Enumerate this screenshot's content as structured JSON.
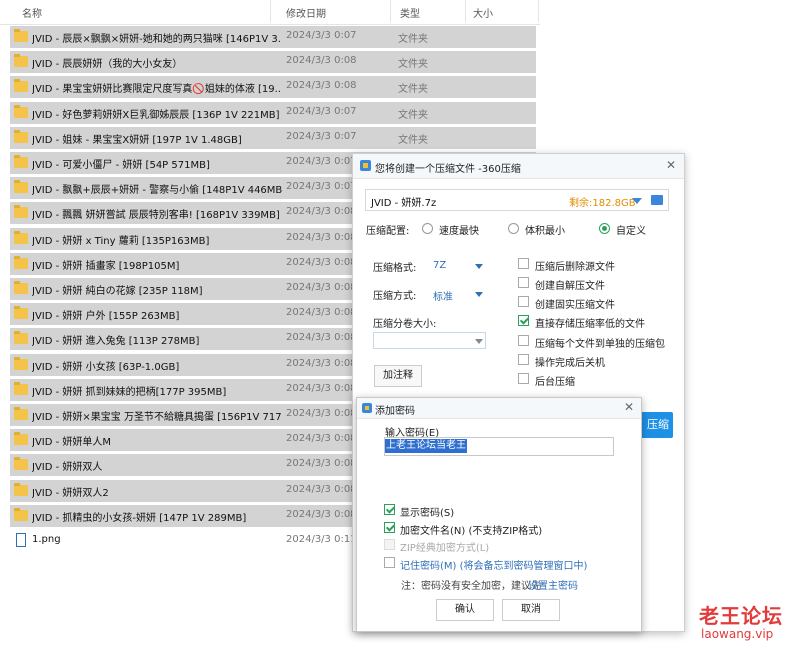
{
  "explorer": {
    "columns": {
      "name": "名称",
      "date": "修改日期",
      "type": "类型",
      "size": "大小"
    },
    "rows": [
      {
        "name": "JVID - 辰辰×飘飘×妍妍-她和她的两只猫咪 [146P1V 3...",
        "date": "2024/3/3 0:07",
        "type": "文件夹",
        "kind": "folder",
        "selected": true
      },
      {
        "name": "JVID - 辰辰妍妍（我的大小女友）",
        "date": "2024/3/3 0:08",
        "type": "文件夹",
        "kind": "folder",
        "selected": true
      },
      {
        "name": "JVID - 果宝宝妍妍比赛限定尺度写真🚫姐妹的体液 [19...",
        "date": "2024/3/3 0:08",
        "type": "文件夹",
        "kind": "folder",
        "selected": true
      },
      {
        "name": "JVID - 好色萝莉妍妍X巨乳御姊辰辰 [136P 1V 221MB]",
        "date": "2024/3/3 0:07",
        "type": "文件夹",
        "kind": "folder",
        "selected": true
      },
      {
        "name": "JVID - 姐妹 - 果宝宝X妍妍 [197P 1V 1.48GB]",
        "date": "2024/3/3 0:07",
        "type": "文件夹",
        "kind": "folder",
        "selected": true
      },
      {
        "name": "JVID - 可爱小僵尸 - 妍妍 [54P 571MB]",
        "date": "2024/3/3 0:07",
        "type": "文件夹",
        "kind": "folder",
        "selected": true
      },
      {
        "name": "JVID - 飘飘+辰辰+妍妍 - 警察与小偷 [148P1V 446MB]",
        "date": "2024/3/3 0:07",
        "type": "文件夹",
        "kind": "folder",
        "selected": true
      },
      {
        "name": "JVID - 飄飄 妍妍嘗試 辰辰特別客串! [168P1V 339MB]",
        "date": "2024/3/3 0:08",
        "type": "文件夹",
        "kind": "folder",
        "selected": true
      },
      {
        "name": "JVID - 妍妍 x Tiny 蘿莉 [135P163MB]",
        "date": "2024/3/3 0:08",
        "type": "",
        "kind": "folder",
        "selected": true
      },
      {
        "name": "JVID - 妍妍 插畫家 [198P105M]",
        "date": "2024/3/3 0:08",
        "type": "",
        "kind": "folder",
        "selected": true
      },
      {
        "name": "JVID - 妍妍 純白の花嫁 [235P 118M]",
        "date": "2024/3/3 0:08",
        "type": "",
        "kind": "folder",
        "selected": true
      },
      {
        "name": "JVID - 妍妍 户外 [155P 263MB]",
        "date": "2024/3/3 0:08",
        "type": "",
        "kind": "folder",
        "selected": true
      },
      {
        "name": "JVID - 妍妍 進入兔兔 [113P 278MB]",
        "date": "2024/3/3 0:08",
        "type": "",
        "kind": "folder",
        "selected": true
      },
      {
        "name": "JVID - 妍妍 小女孩 [63P-1.0GB]",
        "date": "2024/3/3 0:08",
        "type": "",
        "kind": "folder",
        "selected": true
      },
      {
        "name": "JVID - 妍妍 抓到妹妹的把柄[177P 395MB]",
        "date": "2024/3/3 0:08",
        "type": "",
        "kind": "folder",
        "selected": true
      },
      {
        "name": "JVID - 妍妍×果宝宝 万圣节不給糖具搗蛋 [156P1V 717...",
        "date": "2024/3/3 0:08",
        "type": "",
        "kind": "folder",
        "selected": true
      },
      {
        "name": "JVID - 妍妍单人M",
        "date": "2024/3/3 0:08",
        "type": "",
        "kind": "folder",
        "selected": true
      },
      {
        "name": "JVID - 妍妍双人",
        "date": "2024/3/3 0:08",
        "type": "",
        "kind": "folder",
        "selected": true
      },
      {
        "name": "JVID - 妍妍双人2",
        "date": "2024/3/3 0:08",
        "type": "",
        "kind": "folder",
        "selected": true
      },
      {
        "name": "JVID - 抓精虫的小女孩-妍妍 [147P 1V 289MB]",
        "date": "2024/3/3 0:08",
        "type": "",
        "kind": "folder",
        "selected": true
      },
      {
        "name": "1.png",
        "date": "2024/3/3 0:11",
        "type": "",
        "kind": "file",
        "selected": false
      }
    ]
  },
  "compress_dialog": {
    "title": "您将创建一个压缩文件 -360压缩",
    "filename": "JVID - 妍妍.7z",
    "free_space": "剩余:182.8GB",
    "config_label": "压缩配置:",
    "presets": [
      "速度最快",
      "体积最小",
      "自定义"
    ],
    "selected_preset": "自定义",
    "format_label": "压缩格式:",
    "format_value": "7Z",
    "method_label": "压缩方式:",
    "method_value": "标准",
    "split_label": "压缩分卷大小:",
    "note_button": "加注释",
    "options": [
      {
        "label": "压缩后删除源文件",
        "checked": false
      },
      {
        "label": "创建自解压文件",
        "checked": false
      },
      {
        "label": "创建固实压缩文件",
        "checked": false
      },
      {
        "label": "直接存储压缩率低的文件",
        "checked": true
      },
      {
        "label": "压缩每个文件到单独的压缩包",
        "checked": false
      },
      {
        "label": "操作完成后关机",
        "checked": false
      },
      {
        "label": "后台压缩",
        "checked": false
      }
    ],
    "compress_button": "压缩"
  },
  "password_dialog": {
    "title": "添加密码",
    "input_label": "输入密码(E)",
    "password_value": "上老王论坛当老王",
    "options": [
      {
        "label": "显示密码(S)",
        "checked": true,
        "disabled": false
      },
      {
        "label": "加密文件名(N) (不支持ZIP格式)",
        "checked": true,
        "disabled": false
      },
      {
        "label": "ZIP经典加密方式(L)",
        "checked": false,
        "disabled": true
      },
      {
        "label": "记住密码(M) (将会备忘到密码管理窗口中)",
        "checked": false,
        "disabled": false
      }
    ],
    "note_prefix": "注：密码没有安全加密，建议先",
    "note_link": "设置主密码",
    "ok_button": "确认",
    "cancel_button": "取消"
  },
  "watermark": {
    "text": "老王论坛",
    "url": "laowang.vip"
  },
  "colors": {
    "selection": "#d3d3d3",
    "accent": "#1e90e6",
    "check_green": "#2ca05a",
    "free_space": "#e58a00",
    "watermark": "#e33a3a"
  }
}
